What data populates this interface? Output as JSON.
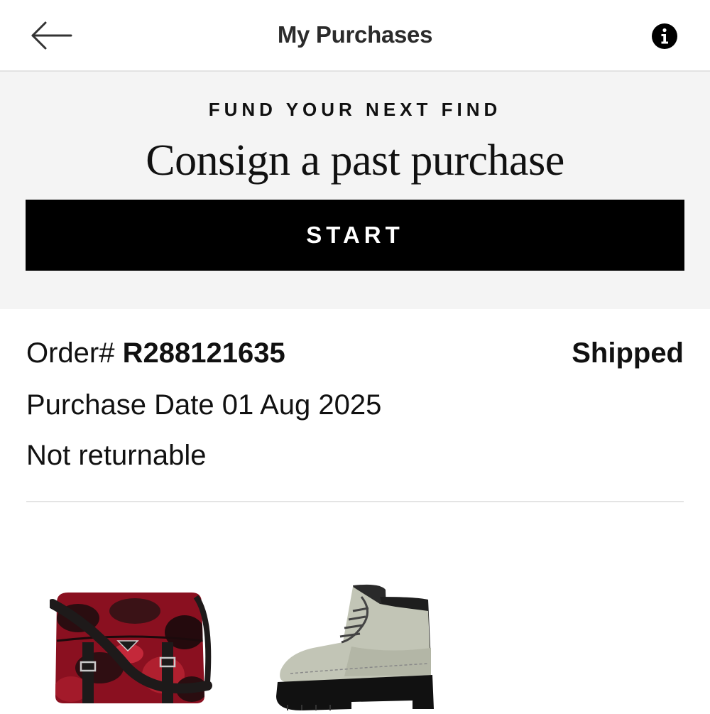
{
  "header": {
    "title": "My Purchases",
    "back_icon": "arrow-left-icon",
    "info_icon": "info-icon"
  },
  "promo": {
    "eyebrow": "FUND YOUR NEXT FIND",
    "heading": "Consign a past purchase",
    "button_label": "START"
  },
  "order": {
    "number_label": "Order#",
    "number_value": "R288121635",
    "status": "Shipped",
    "purchase_date_label": "Purchase Date",
    "purchase_date_value": "01 Aug 2025",
    "return_policy": "Not returnable"
  },
  "products": [
    {
      "image": "red-camo-messenger-bag"
    },
    {
      "image": "grey-lace-up-boot"
    }
  ],
  "colors": {
    "accent": "#000000",
    "promo_bg": "#f4f4f4",
    "divider": "#e4e4e4"
  }
}
